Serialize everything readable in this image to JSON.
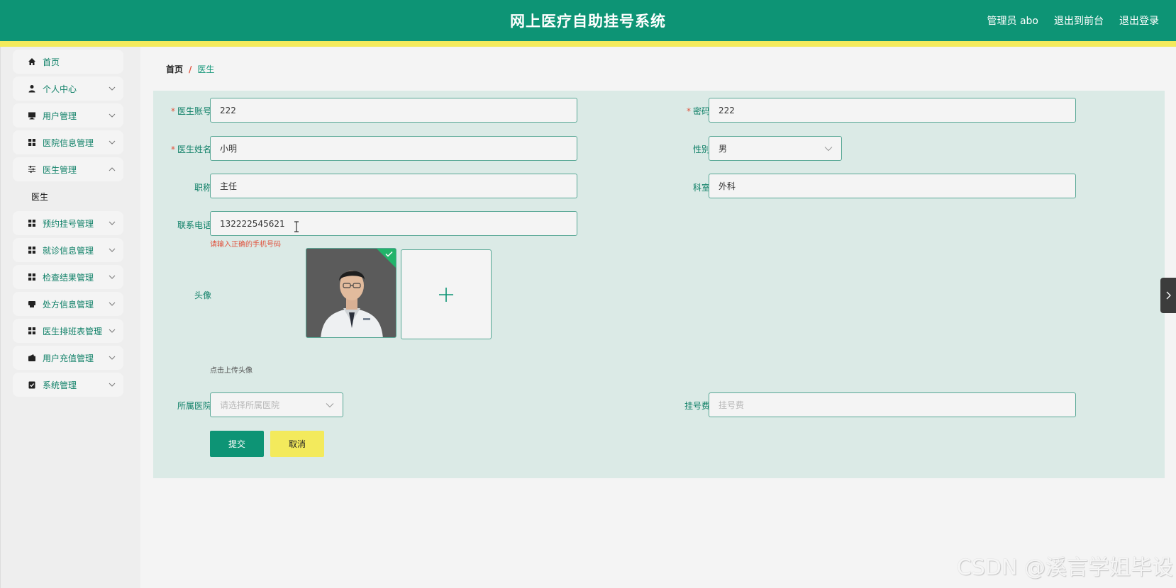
{
  "header": {
    "title": "网上医疗自助挂号系统",
    "links": [
      "管理员 abo",
      "退出到前台",
      "退出登录"
    ],
    "bg_color": "#0d9475",
    "stripe_color": "#f3ea5c"
  },
  "sidebar": {
    "items": [
      {
        "label": "首页",
        "icon": "home-icon",
        "expandable": false
      },
      {
        "label": "个人中心",
        "icon": "user-icon",
        "expandable": true
      },
      {
        "label": "用户管理",
        "icon": "monitor-icon",
        "expandable": true
      },
      {
        "label": "医院信息管理",
        "icon": "grid-icon",
        "expandable": true
      },
      {
        "label": "医生管理",
        "icon": "sliders-icon",
        "expandable": true
      },
      {
        "label": "预约挂号管理",
        "icon": "grid-icon",
        "expandable": true
      },
      {
        "label": "就诊信息管理",
        "icon": "grid-icon",
        "expandable": true
      },
      {
        "label": "检查结果管理",
        "icon": "grid-icon",
        "expandable": true
      },
      {
        "label": "处方信息管理",
        "icon": "printer-icon",
        "expandable": true
      },
      {
        "label": "医生排班表管理",
        "icon": "grid-icon",
        "expandable": true
      },
      {
        "label": "用户充值管理",
        "icon": "wallet-icon",
        "expandable": true
      },
      {
        "label": "系统管理",
        "icon": "clipboard-icon",
        "expandable": true
      }
    ],
    "submenu": {
      "parent": "医生管理",
      "label": "医生"
    }
  },
  "breadcrumb": {
    "home": "首页",
    "separator": "/",
    "current": "医生"
  },
  "form": {
    "doctor_account": {
      "label": "医生账号",
      "value": "222",
      "required": true
    },
    "password": {
      "label": "密码",
      "value": "222",
      "required": true
    },
    "doctor_name": {
      "label": "医生姓名",
      "value": "小明",
      "required": true
    },
    "gender": {
      "label": "性别",
      "value": "男"
    },
    "title": {
      "label": "职称",
      "value": "主任"
    },
    "department": {
      "label": "科室",
      "value": "外科"
    },
    "phone": {
      "label": "联系电话",
      "value": "132222545621",
      "error": "请输入正确的手机号码"
    },
    "avatar": {
      "label": "头像",
      "hint": "点击上传头像"
    },
    "hospital": {
      "label": "所属医院",
      "placeholder": "请选择所属医院"
    },
    "fee": {
      "label": "挂号费",
      "placeholder": "挂号费"
    },
    "submit_label": "提交",
    "cancel_label": "取消"
  },
  "watermark": "CSDN @溪言学姐毕设",
  "colors": {
    "accent": "#0d9475",
    "panel": "#dbeae6",
    "error": "#e0533e",
    "cancel": "#f3ea5c"
  }
}
